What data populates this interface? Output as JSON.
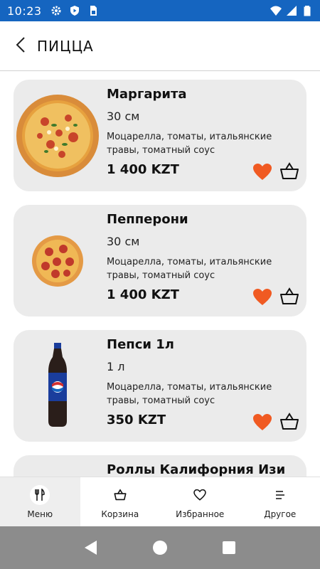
{
  "status_bar": {
    "time": "10:23",
    "left_icons": [
      "gear-icon",
      "shield-play-icon",
      "sim-card-icon"
    ],
    "right_icons": [
      "wifi-icon",
      "signal-icon",
      "battery-icon"
    ],
    "background_color": "#1565c0"
  },
  "header": {
    "title": "ПИЦЦА",
    "back_icon": "chevron-left-icon"
  },
  "products": [
    {
      "name": "Маргарита",
      "size": "30 см",
      "description": "Моцарелла, томаты, итальянские травы, томатный соус",
      "price": "1 400 KZT",
      "image": "pizza-margherita-image"
    },
    {
      "name": "Пепперони",
      "size": "30 см",
      "description": "Моцарелла, томаты, итальянские травы, томатный соус",
      "price": "1 400 KZT",
      "image": "pizza-pepperoni-image"
    },
    {
      "name": "Пепси 1л",
      "size": "1 л",
      "description": "Моцарелла, томаты, итальянские травы, томатный соус",
      "price": "350 KZT",
      "image": "pepsi-bottle-image"
    },
    {
      "name": "Роллы Калифорния Изи"
    }
  ],
  "colors": {
    "favorite": "#f05a22",
    "card_background": "#ebebeb",
    "system_nav": "#8c8c8c"
  },
  "bottom_nav": {
    "items": [
      {
        "label": "Меню",
        "icon": "fork-knife-icon",
        "active": true
      },
      {
        "label": "Корзина",
        "icon": "basket-icon",
        "active": false
      },
      {
        "label": "Избранное",
        "icon": "heart-outline-icon",
        "active": false
      },
      {
        "label": "Другое",
        "icon": "menu-lines-icon",
        "active": false
      }
    ]
  },
  "system_nav": {
    "buttons": [
      "back-triangle-icon",
      "home-circle-icon",
      "recents-square-icon"
    ]
  }
}
